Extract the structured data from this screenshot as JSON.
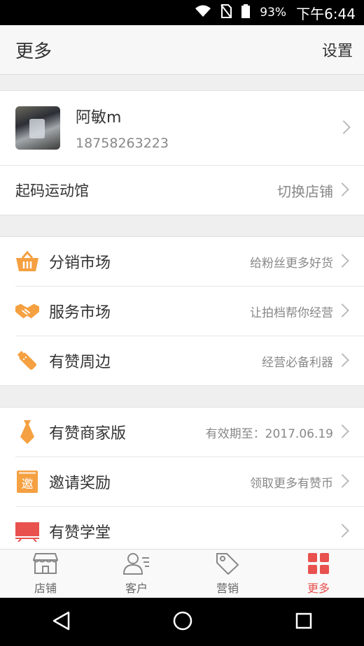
{
  "status_bar": {
    "battery": "93%",
    "time": "下午6:44"
  },
  "header": {
    "title": "更多",
    "settings_label": "设置"
  },
  "profile": {
    "name": "阿敏m",
    "phone": "18758263223"
  },
  "store": {
    "name": "起码运动馆",
    "switch_label": "切换店铺"
  },
  "menu_group_1": [
    {
      "label": "分销市场",
      "hint": "给粉丝更多好货",
      "icon": "basket-icon"
    },
    {
      "label": "服务市场",
      "hint": "让拍档帮你经营",
      "icon": "handshake-icon"
    },
    {
      "label": "有赞周边",
      "hint": "经营必备利器",
      "icon": "usb-icon"
    }
  ],
  "menu_group_2": [
    {
      "label": "有赞商家版",
      "hint": "有效期至：2017.06.19",
      "icon": "tie-icon"
    },
    {
      "label": "邀请奖励",
      "hint": "领取更多有赞币",
      "icon": "invite-icon",
      "icon_text": "邀"
    },
    {
      "label": "有赞学堂",
      "hint": "",
      "icon": "board-icon"
    }
  ],
  "tabs": [
    {
      "label": "店铺",
      "icon": "store-icon"
    },
    {
      "label": "客户",
      "icon": "customer-icon"
    },
    {
      "label": "营销",
      "icon": "tag-icon"
    },
    {
      "label": "更多",
      "icon": "grid-icon",
      "active": true
    }
  ],
  "colors": {
    "accent": "#e8514e",
    "orange": "#f5a041"
  }
}
